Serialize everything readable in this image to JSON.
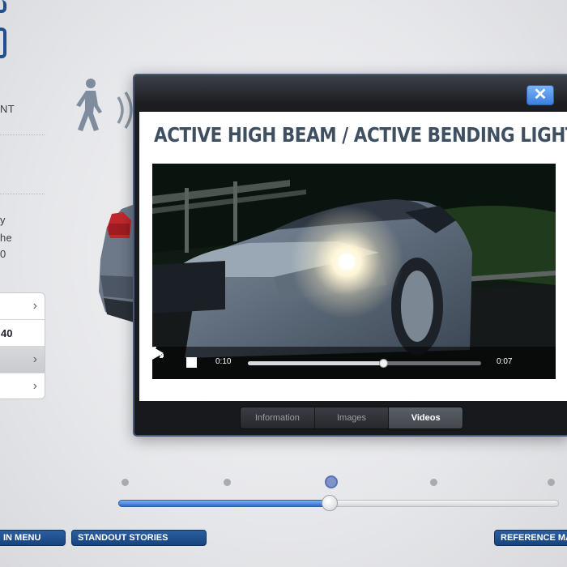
{
  "background": {
    "left_panel": {
      "text_fragments": [
        "NT",
        "y",
        "he",
        "0"
      ],
      "list_items": [
        {
          "label": ""
        },
        {
          "label": "40"
        },
        {
          "label": ""
        },
        {
          "label": ""
        }
      ]
    }
  },
  "modal": {
    "title": "ACTIVE HIGH BEAM / ACTIVE BENDING LIGHT",
    "close_label": "✕",
    "video": {
      "elapsed": "0:10",
      "remaining": "0:07",
      "progress": 0.58
    },
    "tabs": [
      {
        "label": "Information",
        "active": false
      },
      {
        "label": "Images",
        "active": false
      },
      {
        "label": "Videos",
        "active": true
      }
    ]
  },
  "timeline": {
    "steps": 5,
    "current_step": 3,
    "position": 0.48
  },
  "bottom_nav": {
    "main_menu": "IN MENU",
    "standout_stories": "STANDOUT STORIES",
    "reference": "REFERENCE MA"
  },
  "colors": {
    "accent_blue": "#1f4f8c",
    "slider_fill": "#2f69c9",
    "title_color": "#3f4f62"
  }
}
